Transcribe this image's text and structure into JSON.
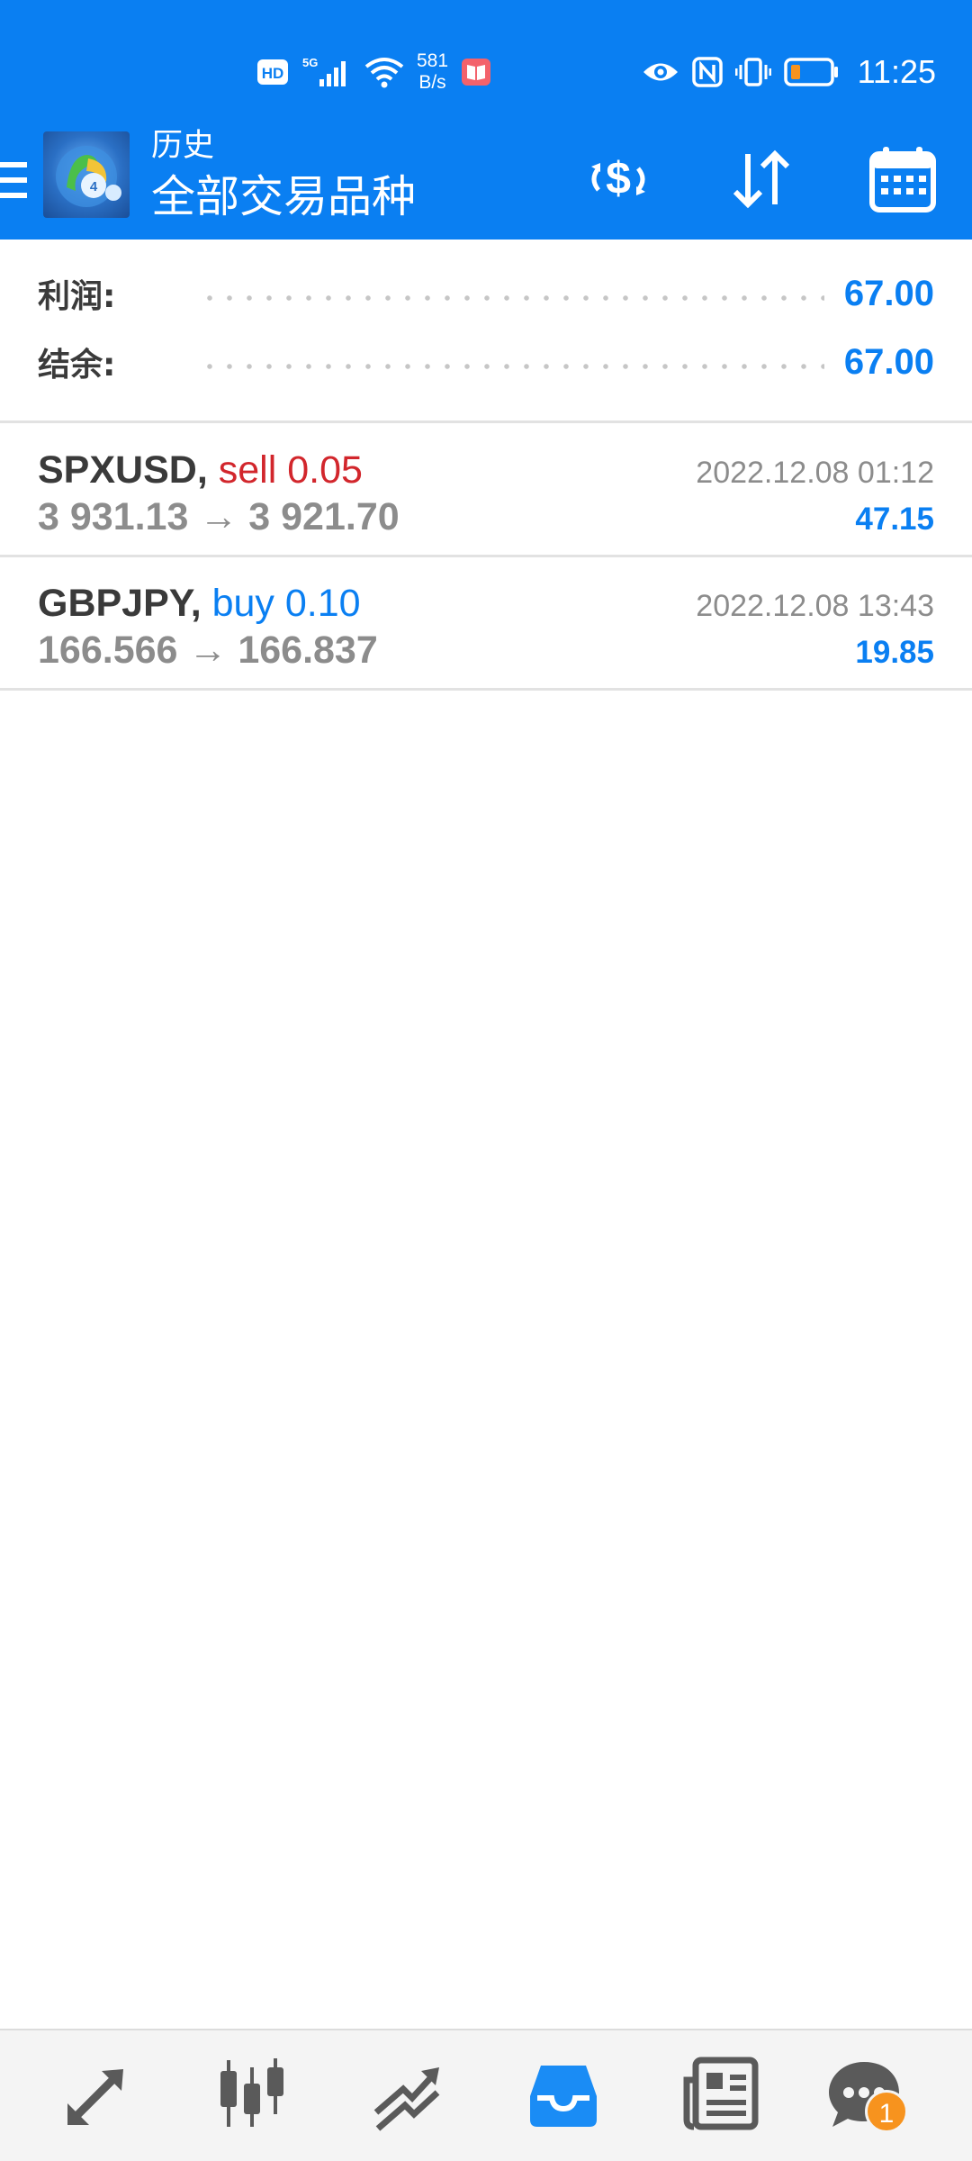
{
  "status_bar": {
    "network_speed_value": "581",
    "network_speed_unit": "B/s",
    "time": "11:25",
    "icons": [
      "hd-icon",
      "5g-signal-icon",
      "wifi-icon",
      "notification-book-icon",
      "eye-icon",
      "nfc-icon",
      "vibrate-icon",
      "battery-low-icon"
    ]
  },
  "app_bar": {
    "title": "历史",
    "subtitle": "全部交易品种",
    "actions": [
      "swap-currency-icon",
      "sort-icon",
      "calendar-icon"
    ]
  },
  "summary": {
    "profit_label": "利润:",
    "profit_value": "67.00",
    "balance_label": "结余:",
    "balance_value": "67.00"
  },
  "deals": [
    {
      "symbol": "SPXUSD,",
      "side_volume": "sell 0.05",
      "side": "sell",
      "prices": "3 931.13 → 3 921.70",
      "time": "2022.12.08 01:12",
      "profit": "47.15"
    },
    {
      "symbol": "GBPJPY,",
      "side_volume": "buy 0.10",
      "side": "buy",
      "prices": "166.566 → 166.837",
      "time": "2022.12.08 13:43",
      "profit": "19.85"
    }
  ],
  "bottom_nav": {
    "items": [
      "quotes-icon",
      "chart-icon",
      "trade-icon",
      "history-icon",
      "news-icon",
      "chat-icon"
    ],
    "active": "history-icon",
    "chat_badge": "1"
  },
  "colors": {
    "accent": "#0a7ff2",
    "sell": "#d2262c",
    "badge": "#f7931e"
  }
}
